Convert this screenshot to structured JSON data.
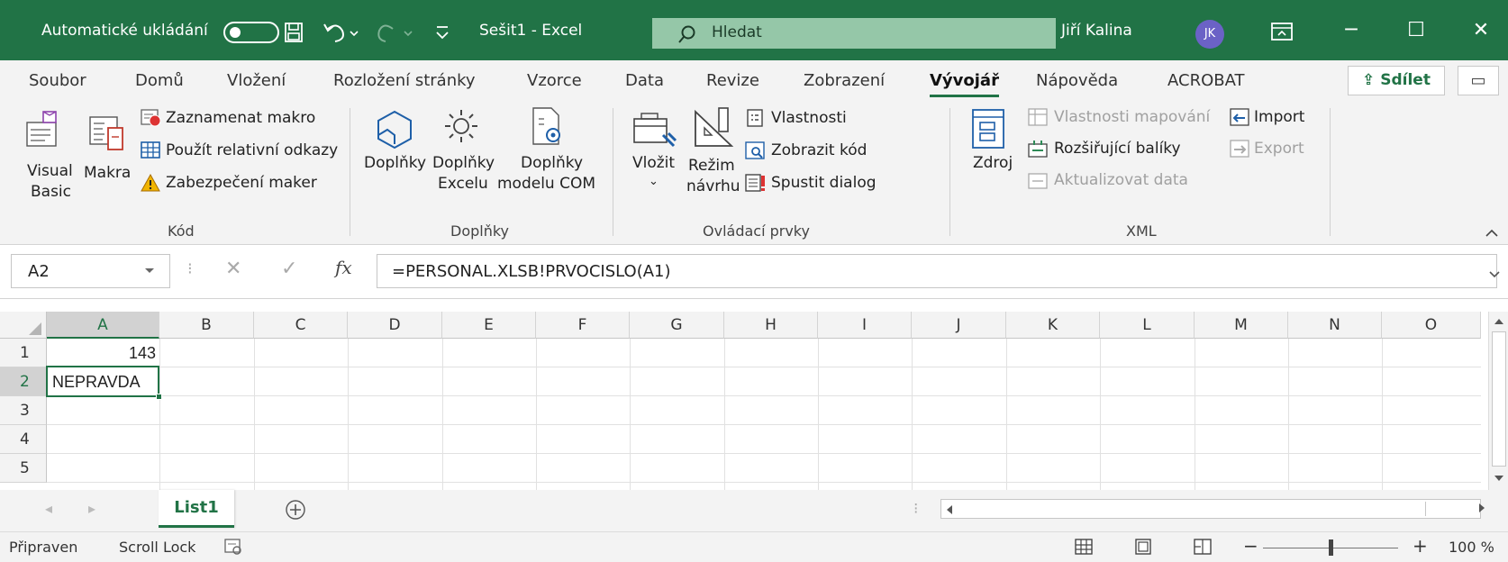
{
  "titlebar": {
    "autosave_label": "Automatické ukládání",
    "file_title": "Sešit1  -  Excel",
    "search_placeholder": "Hledat",
    "user_name": "Jiří Kalina",
    "user_initials": "JK",
    "accent": "#217346"
  },
  "menu": {
    "tabs": [
      "Soubor",
      "Domů",
      "Vložení",
      "Rozložení stránky",
      "Vzorce",
      "Data",
      "Revize",
      "Zobrazení",
      "Vývojář",
      "Nápověda",
      "ACROBAT"
    ],
    "active_tab": "Vývojář",
    "share_label": "Sdílet"
  },
  "ribbon": {
    "code": {
      "visual_basic": [
        "Visual",
        "Basic"
      ],
      "macros": "Makra",
      "record_macro": "Zaznamenat makro",
      "relative_refs": "Použít relativní odkazy",
      "macro_security": "Zabezpečení maker",
      "group": "Kód"
    },
    "addins": {
      "addins": "Doplňky",
      "excel_addins": [
        "Doplňky",
        "Excelu"
      ],
      "com_addins": [
        "Doplňky",
        "modelu COM"
      ],
      "group": "Doplňky"
    },
    "controls": {
      "insert": "Vložit",
      "design_mode": [
        "Režim",
        "návrhu"
      ],
      "properties": "Vlastnosti",
      "view_code": "Zobrazit kód",
      "run_dialog": "Spustit dialog",
      "group": "Ovládací prvky"
    },
    "xml": {
      "source": "Zdroj",
      "map_properties": "Vlastnosti mapování",
      "expansion_packs": "Rozšiřující balíky",
      "refresh_data": "Aktualizovat data",
      "import": "Import",
      "export": "Export",
      "group": "XML"
    }
  },
  "formula_bar": {
    "name_box": "A2",
    "formula": "=PERSONAL.XLSB!PRVOCISLO(A1)"
  },
  "grid": {
    "columns": [
      "A",
      "B",
      "C",
      "D",
      "E",
      "F",
      "G",
      "H",
      "I",
      "J",
      "K",
      "L",
      "M",
      "N",
      "O"
    ],
    "rows": [
      "1",
      "2",
      "3",
      "4",
      "5"
    ],
    "cells": {
      "A1": "143",
      "A2": "NEPRAVDA"
    }
  },
  "sheets": {
    "tabs": [
      "List1"
    ]
  },
  "status": {
    "ready": "Připraven",
    "scroll_lock": "Scroll Lock",
    "zoom": "100 %",
    "zoom_fraction": 0.5
  }
}
